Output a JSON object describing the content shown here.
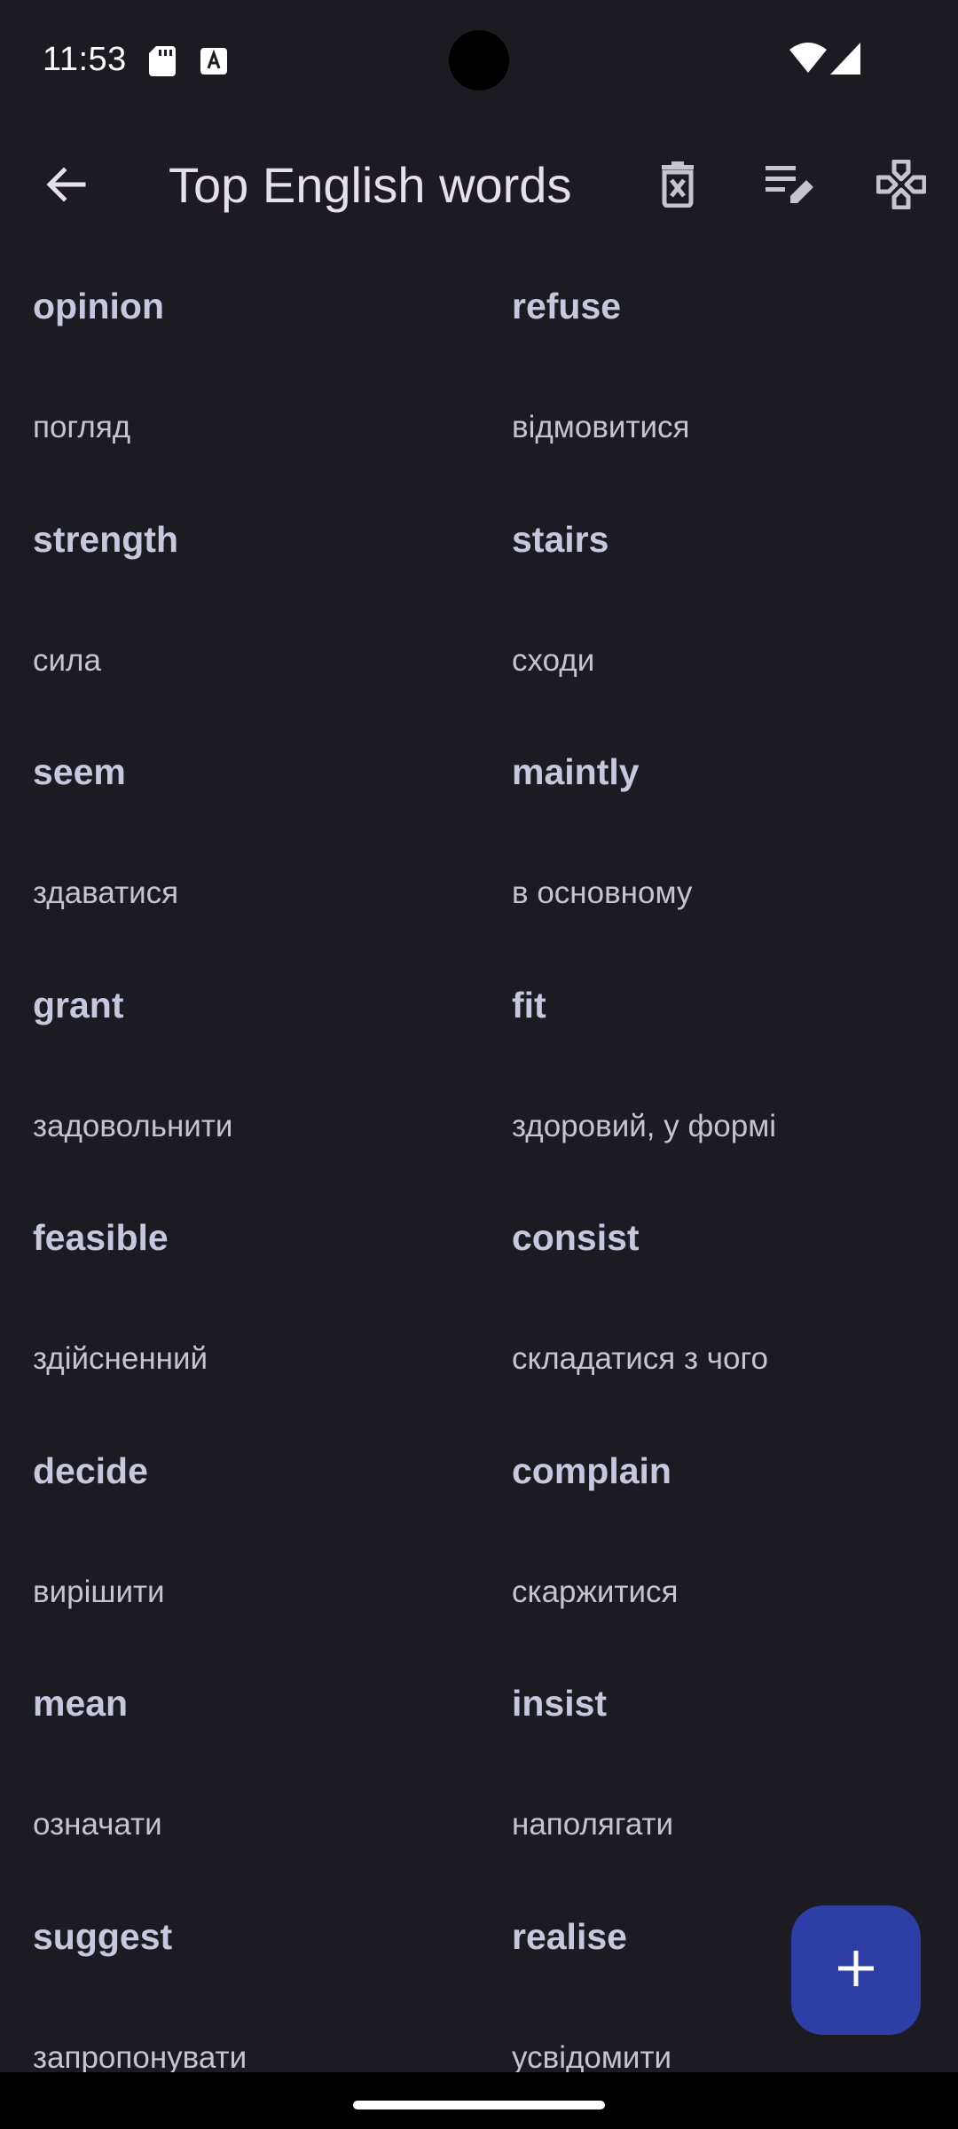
{
  "status_bar": {
    "time": "11:53",
    "icons": [
      "sd-card-icon",
      "text-a-icon",
      "wifi-icon",
      "signal-icon"
    ]
  },
  "app_bar": {
    "title": "Top English words",
    "actions": [
      "back-arrow-icon",
      "delete-list-icon",
      "edit-list-icon",
      "gamepad-icon"
    ]
  },
  "words": [
    {
      "en": "opinion",
      "tr": "погляд"
    },
    {
      "en": "refuse",
      "tr": "відмовитися"
    },
    {
      "en": "strength",
      "tr": "сила"
    },
    {
      "en": "stairs",
      "tr": "сходи"
    },
    {
      "en": "seem",
      "tr": "здаватися"
    },
    {
      "en": "maintly",
      "tr": "в основному"
    },
    {
      "en": "grant",
      "tr": "задовольнити"
    },
    {
      "en": "fit",
      "tr": "здоровий, у формі"
    },
    {
      "en": "feasible",
      "tr": "здійсненний"
    },
    {
      "en": "consist",
      "tr": "складатися з чого"
    },
    {
      "en": "decide",
      "tr": "вирішити"
    },
    {
      "en": "complain",
      "tr": "скаржитися"
    },
    {
      "en": "mean",
      "tr": "означати"
    },
    {
      "en": "insist",
      "tr": "наполягати"
    },
    {
      "en": "suggest",
      "tr": "запропонувати"
    },
    {
      "en": "realise",
      "tr": "усвідомити"
    }
  ],
  "fab": {
    "icon": "plus-icon"
  },
  "colors": {
    "background": "#1c1b21",
    "word_primary": "#c9c6e0",
    "word_secondary": "#c6c4cc",
    "fab": "#2d3ea6"
  }
}
